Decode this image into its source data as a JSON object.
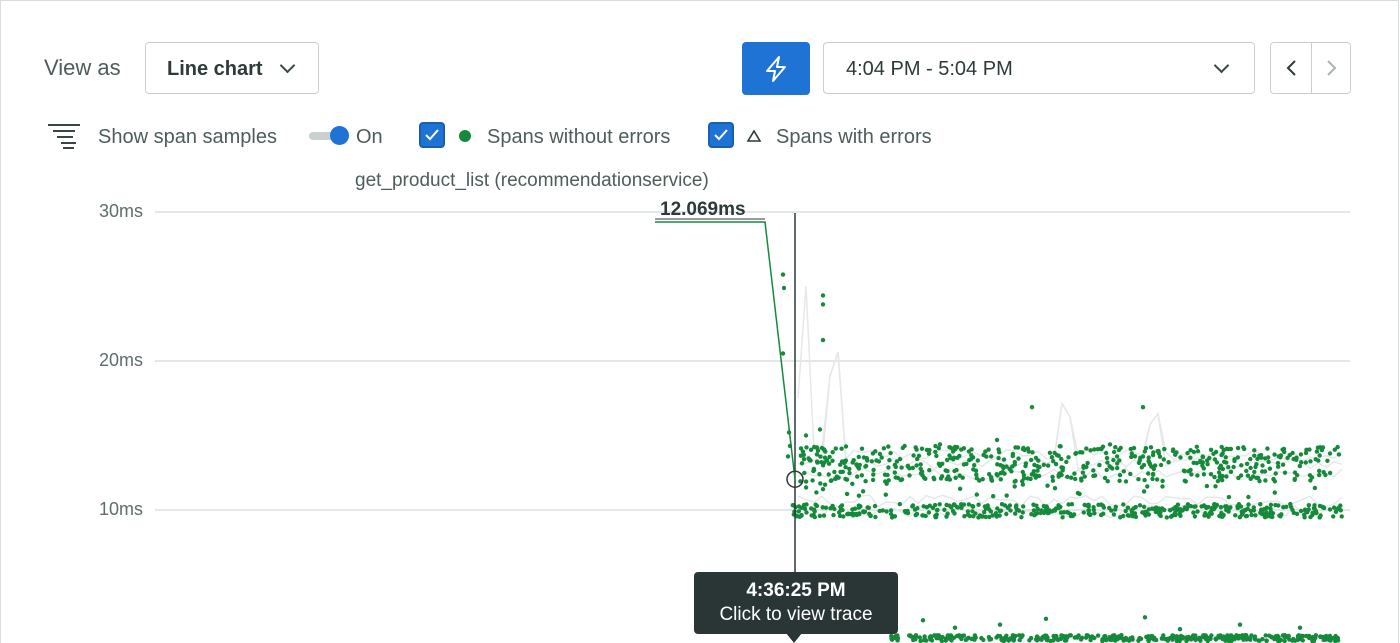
{
  "toolbar": {
    "view_as_label": "View as",
    "view_selected": "Line chart",
    "time_range": "4:04 PM - 5:04 PM"
  },
  "controls": {
    "show_span_samples": "Show span samples",
    "toggle_state": "On",
    "legend_no_errors": "Spans without errors",
    "legend_errors": "Spans with errors"
  },
  "chart_data": {
    "type": "scatter",
    "title": "get_product_list (recommendationservice)",
    "ylim": [
      0,
      30
    ],
    "y_ticks": [
      "30ms",
      "20ms",
      "10ms"
    ],
    "y_tick_values": [
      30,
      20,
      10
    ],
    "grid": true,
    "series": [
      {
        "name": "Spans without errors",
        "color": "#148a3a"
      },
      {
        "name": "Spans with errors",
        "color": "#2d3a3a"
      }
    ],
    "hover": {
      "value_label": "12.069ms",
      "value": 12.069,
      "time": "4:36:25 PM",
      "action": "Click to view trace"
    }
  },
  "colors": {
    "accent": "#1f73d4",
    "success": "#148a3a",
    "tooltip_bg": "#2a3535"
  },
  "icons": {
    "samples": "span-samples-icon",
    "bolt": "bolt-icon",
    "chevron": "chevron-down-icon",
    "prev": "chevron-left-icon",
    "next": "chevron-right-icon"
  }
}
